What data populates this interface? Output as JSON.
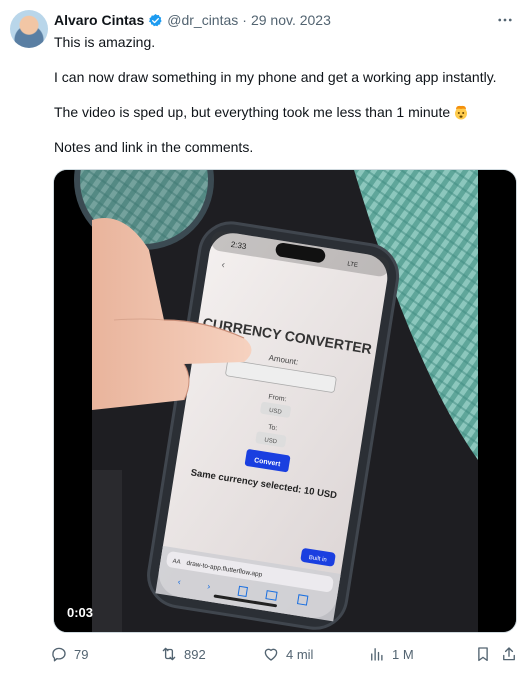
{
  "author": {
    "name": "Alvaro Cintas",
    "handle": "@dr_cintas",
    "separator": "·",
    "date": "29 nov. 2023"
  },
  "tweet": {
    "line1": "This is amazing.",
    "line2": "I can now draw something in my phone and get a working app instantly.",
    "line3": "The video is sped up, but everything took me less than 1 minute",
    "line4": "Notes and link in the comments."
  },
  "media": {
    "timestamp": "0:03",
    "phone": {
      "status_time": "2:33",
      "status_right": "LTE",
      "title": "CURRENCY CONVERTER",
      "amount_label": "Amount:",
      "from_label": "From:",
      "from_value": "USD",
      "to_label": "To:",
      "to_value": "USD",
      "convert_button": "Convert",
      "result": "Same currency selected: 10 USD",
      "badge": "Built in",
      "url_prefix": "AA",
      "url": "draw-to-app.flutterflow.app"
    }
  },
  "actions": {
    "replies": "79",
    "reposts": "892",
    "likes": "4 mil",
    "views": "1 M"
  },
  "colors": {
    "accent": "#1d9bf0",
    "muted": "#536471",
    "convert_button": "#1a3fe0"
  }
}
